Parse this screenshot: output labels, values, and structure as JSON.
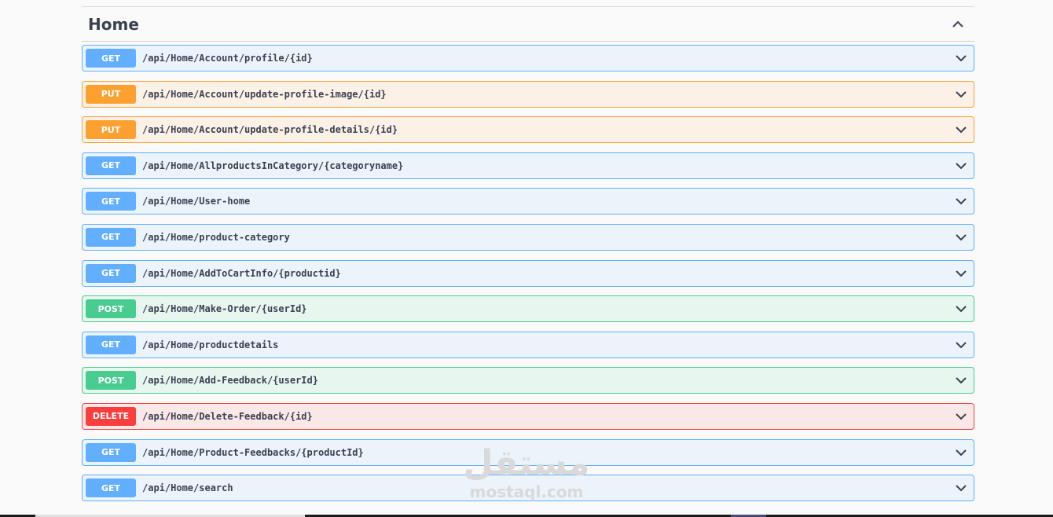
{
  "section": {
    "title": "Home"
  },
  "operations": [
    {
      "method": "GET",
      "path": "/api/Home/Account/profile/{id}"
    },
    {
      "method": "PUT",
      "path": "/api/Home/Account/update-profile-image/{id}"
    },
    {
      "method": "PUT",
      "path": "/api/Home/Account/update-profile-details/{id}"
    },
    {
      "method": "GET",
      "path": "/api/Home/AllproductsInCategory/{categoryname}"
    },
    {
      "method": "GET",
      "path": "/api/Home/User-home"
    },
    {
      "method": "GET",
      "path": "/api/Home/product-category"
    },
    {
      "method": "GET",
      "path": "/api/Home/AddToCartInfo/{productid}"
    },
    {
      "method": "POST",
      "path": "/api/Home/Make-Order/{userId}"
    },
    {
      "method": "GET",
      "path": "/api/Home/productdetails"
    },
    {
      "method": "POST",
      "path": "/api/Home/Add-Feedback/{userId}"
    },
    {
      "method": "DELETE",
      "path": "/api/Home/Delete-Feedback/{id}"
    },
    {
      "method": "GET",
      "path": "/api/Home/Product-Feedbacks/{productId}"
    },
    {
      "method": "GET",
      "path": "/api/Home/search"
    }
  ],
  "icons": {
    "collapse": "chevron-up-icon",
    "expand": "chevron-down-icon"
  },
  "colors": {
    "GET": "#61affe",
    "PUT": "#fca130",
    "POST": "#49cc90",
    "DELETE": "#f93e3e"
  },
  "watermark": {
    "logo": "مستقل",
    "text": "mostaql.com"
  }
}
